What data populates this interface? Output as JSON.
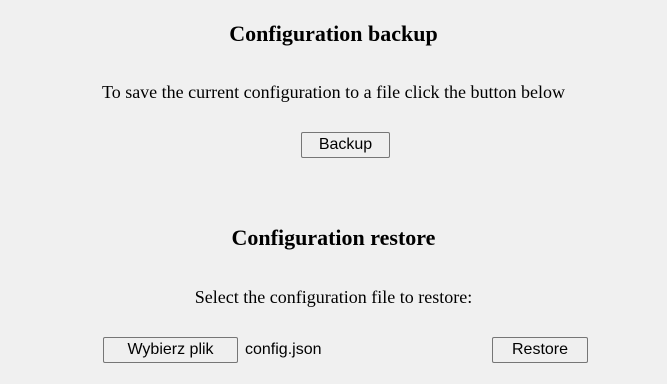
{
  "backup": {
    "title": "Configuration backup",
    "description": "To save the current configuration to a file click the button below",
    "button_label": "Backup"
  },
  "restore": {
    "title": "Configuration restore",
    "description": "Select the configuration file to restore:",
    "file_button_label": "Wybierz plik",
    "selected_file": "config.json",
    "button_label": "Restore"
  }
}
